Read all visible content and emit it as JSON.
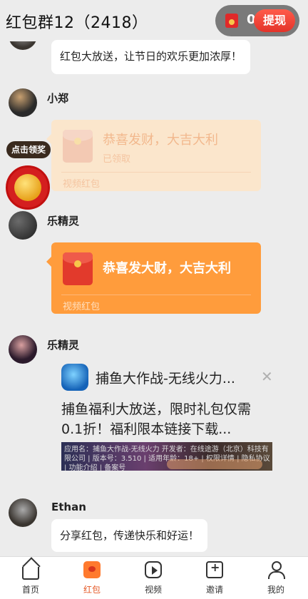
{
  "header": {
    "title": "红包群12（2418）",
    "balance": "0",
    "withdraw_label": "提现"
  },
  "messages": [
    {
      "type": "text",
      "text": "红包大放送，让节日的欢乐更加浓厚！"
    },
    {
      "type": "redpacket",
      "sender": "小郑",
      "title": "恭喜发财，大吉大利",
      "status": "已领取",
      "footer": "视频红包",
      "state": "claimed"
    },
    {
      "type": "redpacket",
      "sender": "乐精灵",
      "title": "恭喜发大财，大吉大利",
      "footer": "视频红包",
      "state": "unclaimed"
    },
    {
      "type": "ad",
      "sender": "乐精灵",
      "app_title": "捕鱼大作战-无线火力...",
      "desc": "捕鱼福利大放送，限时礼包仅需0.1折！福利限本链接下载...",
      "fine_print": "应用名：捕鱼大作战-无线火力 开发者：在线途游（北京）科技有限公司 | 版本号：3.510 | 适用年龄：18+ | 权限详情 | 隐私协议 | 功能介绍 | 备案号"
    },
    {
      "type": "text",
      "sender": "Ethan",
      "text": "分享红包，传递快乐和好运！"
    }
  ],
  "floating": {
    "claim_label": "点击领奖"
  },
  "tabbar": [
    {
      "label": "首页",
      "icon": "home-icon"
    },
    {
      "label": "红包",
      "icon": "red-packet-icon",
      "active": true
    },
    {
      "label": "视频",
      "icon": "video-icon"
    },
    {
      "label": "邀请",
      "icon": "invite-icon"
    },
    {
      "label": "我的",
      "icon": "profile-icon"
    }
  ],
  "colors": {
    "accent": "#ff9c3c",
    "active_tab": "#e55a28",
    "withdraw": "#e3332a"
  }
}
